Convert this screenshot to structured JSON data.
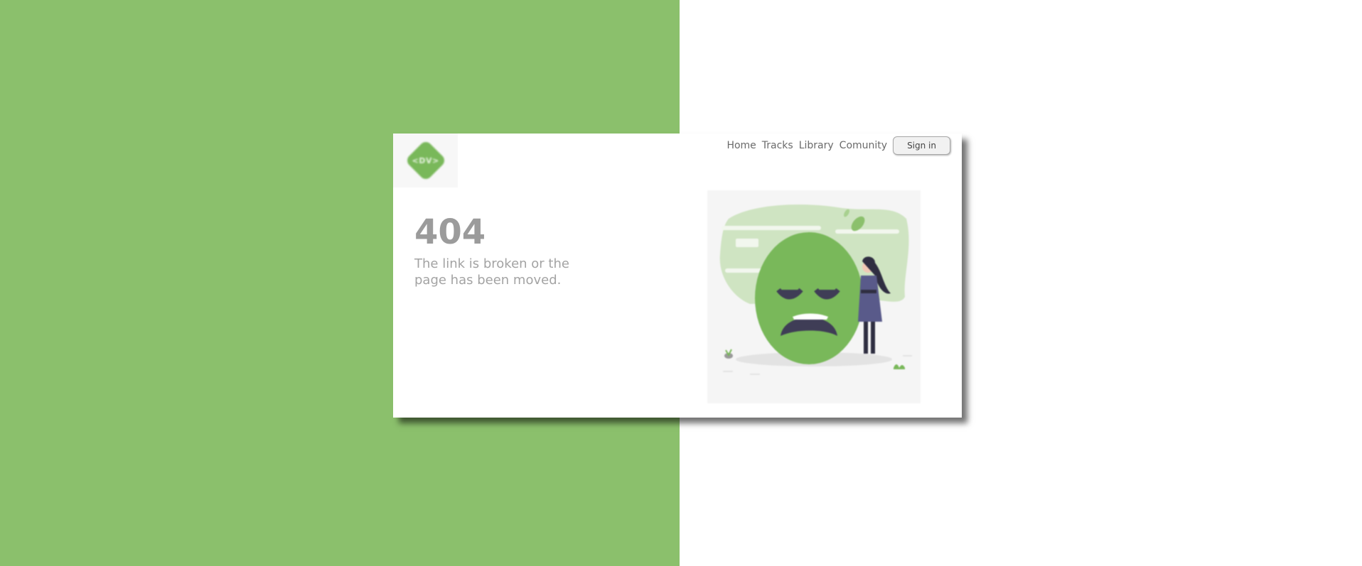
{
  "brand": {
    "logo_text": "<DV>"
  },
  "nav": {
    "items": [
      "Home",
      "Tracks",
      "Library",
      "Comunity"
    ],
    "signin_label": "Sign in"
  },
  "error": {
    "code": "404",
    "message": "The link is broken or the page has been moved."
  },
  "colors": {
    "accent_green": "#8bc06c",
    "text_gray": "#9b9b9b"
  }
}
